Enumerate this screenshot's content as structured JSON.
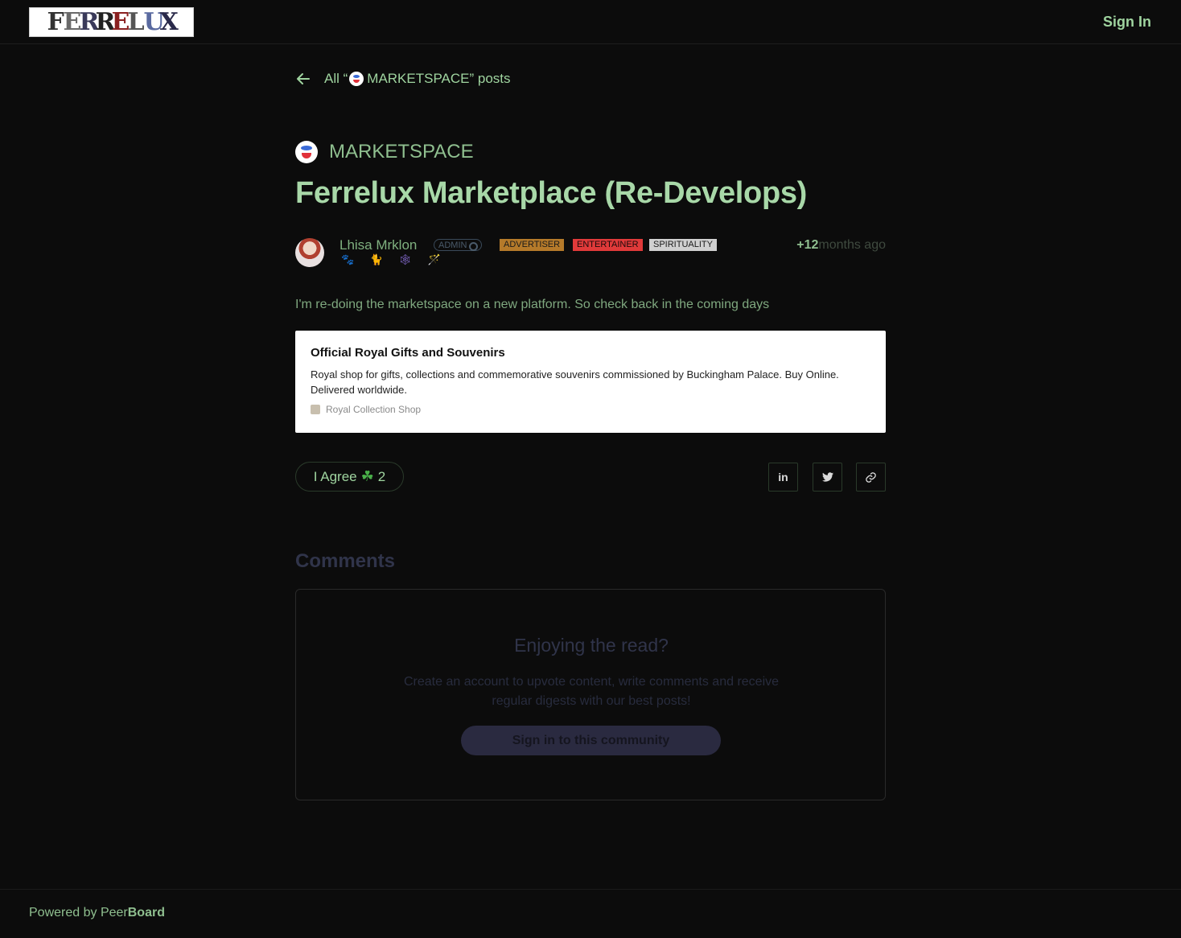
{
  "header": {
    "logo_letters": [
      "F",
      "E",
      "R",
      "R",
      "E",
      "L",
      "U",
      "X"
    ],
    "sign_in_label": "Sign In"
  },
  "nav": {
    "back_prefix": "All “",
    "back_category": "MARKETSPACE",
    "back_suffix": "” posts"
  },
  "post": {
    "category": "MARKETSPACE",
    "title": "Ferrelux Marketplace (Re-Develops)",
    "author": {
      "name": "Lhisa Mrklon",
      "emojis": "🐾 🐈 🕸 🪄",
      "badges": {
        "admin": "ADMIN",
        "advertiser": "ADVERTISER",
        "entertainer": "ENTERTAINER",
        "spirituality": "SPIRITUALITY"
      }
    },
    "time_value": "+12",
    "time_unit": "months ago",
    "body": "I'm re-doing the marketspace on a new platform. So check back in the coming days",
    "link_card": {
      "title": "Official Royal Gifts and Souvenirs",
      "description": "Royal shop for gifts, collections and commemorative souvenirs commissioned by Buckingham Palace. Buy Online. Delivered worldwide.",
      "source": "Royal Collection Shop"
    },
    "reaction": {
      "label": "I Agree",
      "emoji": "☘",
      "count": "2"
    },
    "share": {
      "linkedin": "in",
      "twitter_icon": "twitter-icon",
      "link_icon": "link-icon"
    }
  },
  "comments": {
    "title": "Comments",
    "cta_title": "Enjoying the read?",
    "cta_text": "Create an account to upvote content, write comments and receive regular digests with our best posts!",
    "cta_button": "Sign in to this community"
  },
  "footer": {
    "powered_prefix": "Powered by Peer",
    "powered_brand": "Board"
  }
}
